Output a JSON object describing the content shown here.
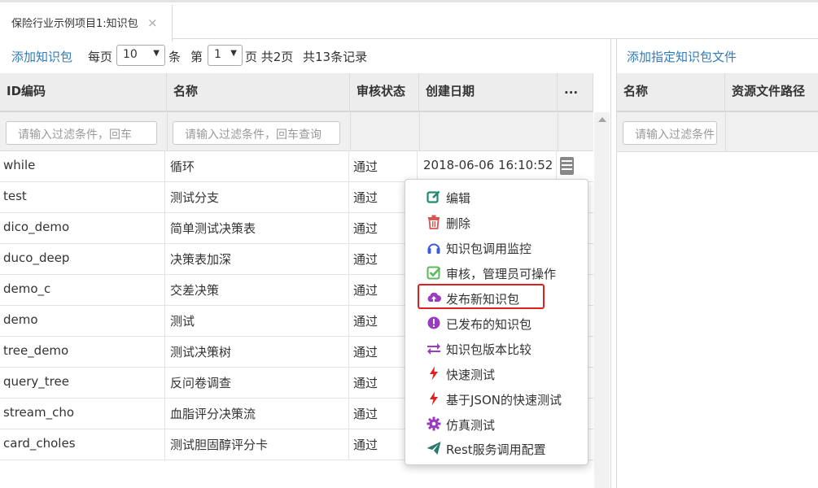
{
  "tab": {
    "title": "保险行业示例项目1:知识包",
    "close": "×"
  },
  "toolbar": {
    "add_label": "添加知识包",
    "per_page_prefix": "每页",
    "per_page_value": "10",
    "per_page_suffix": "条",
    "page_prefix": "第",
    "page_value": "1",
    "page_suffix": "页 共2页",
    "total": "共13条记录"
  },
  "table": {
    "headers": [
      "ID编码",
      "名称",
      "审核状态",
      "创建日期",
      "..."
    ],
    "filter_placeholder_id": "请输入过滤条件，回车",
    "filter_placeholder_name": "请输入过滤条件，回车查询",
    "rows": [
      {
        "id": "while",
        "name": "循环",
        "status": "通过",
        "date": "2018-06-06 16:10:52"
      },
      {
        "id": "test",
        "name": "测试分支",
        "status": "通过",
        "date": ""
      },
      {
        "id": "dico_demo",
        "name": "简单测试决策表",
        "status": "通过",
        "date": ""
      },
      {
        "id": "duco_deep",
        "name": "决策表加深",
        "status": "通过",
        "date": ""
      },
      {
        "id": "demo_c",
        "name": "交差决策",
        "status": "通过",
        "date": ""
      },
      {
        "id": "demo",
        "name": "测试",
        "status": "通过",
        "date": ""
      },
      {
        "id": "tree_demo",
        "name": "测试决策树",
        "status": "通过",
        "date": ""
      },
      {
        "id": "query_tree",
        "name": "反问卷调查",
        "status": "通过",
        "date": ""
      },
      {
        "id": "stream_cho",
        "name": "血脂评分决策流",
        "status": "通过",
        "date": ""
      },
      {
        "id": "card_choles",
        "name": "测试胆固醇评分卡",
        "status": "通过",
        "date": ""
      }
    ]
  },
  "menu": {
    "items": [
      {
        "label": "编辑",
        "icon": "edit-icon",
        "color": "#2aa198"
      },
      {
        "label": "删除",
        "icon": "trash-icon",
        "color": "#d9534f"
      },
      {
        "label": "知识包调用监控",
        "icon": "headphones-icon",
        "color": "#3b5bdb"
      },
      {
        "label": "审核，管理员可操作",
        "icon": "check-square-icon",
        "color": "#5cb85c"
      },
      {
        "label": "发布新知识包",
        "icon": "cloud-upload-icon",
        "color": "#9b3bc0"
      },
      {
        "label": "已发布的知识包",
        "icon": "exclamation-circle-icon",
        "color": "#9b3bc0"
      },
      {
        "label": "知识包版本比较",
        "icon": "exchange-icon",
        "color": "#9b3bc0"
      },
      {
        "label": "快速测试",
        "icon": "bolt-icon",
        "color": "#e02020"
      },
      {
        "label": "基于JSON的快速测试",
        "icon": "bolt-icon",
        "color": "#e02020"
      },
      {
        "label": "仿真测试",
        "icon": "gear-icon",
        "color": "#9b3bc0"
      },
      {
        "label": "Rest服务调用配置",
        "icon": "send-icon",
        "color": "#2a7a6a"
      }
    ]
  },
  "right_panel": {
    "add_label": "添加指定知识包文件",
    "headers": [
      "名称",
      "资源文件路径"
    ],
    "filter_placeholder": "请输入过滤条件"
  }
}
